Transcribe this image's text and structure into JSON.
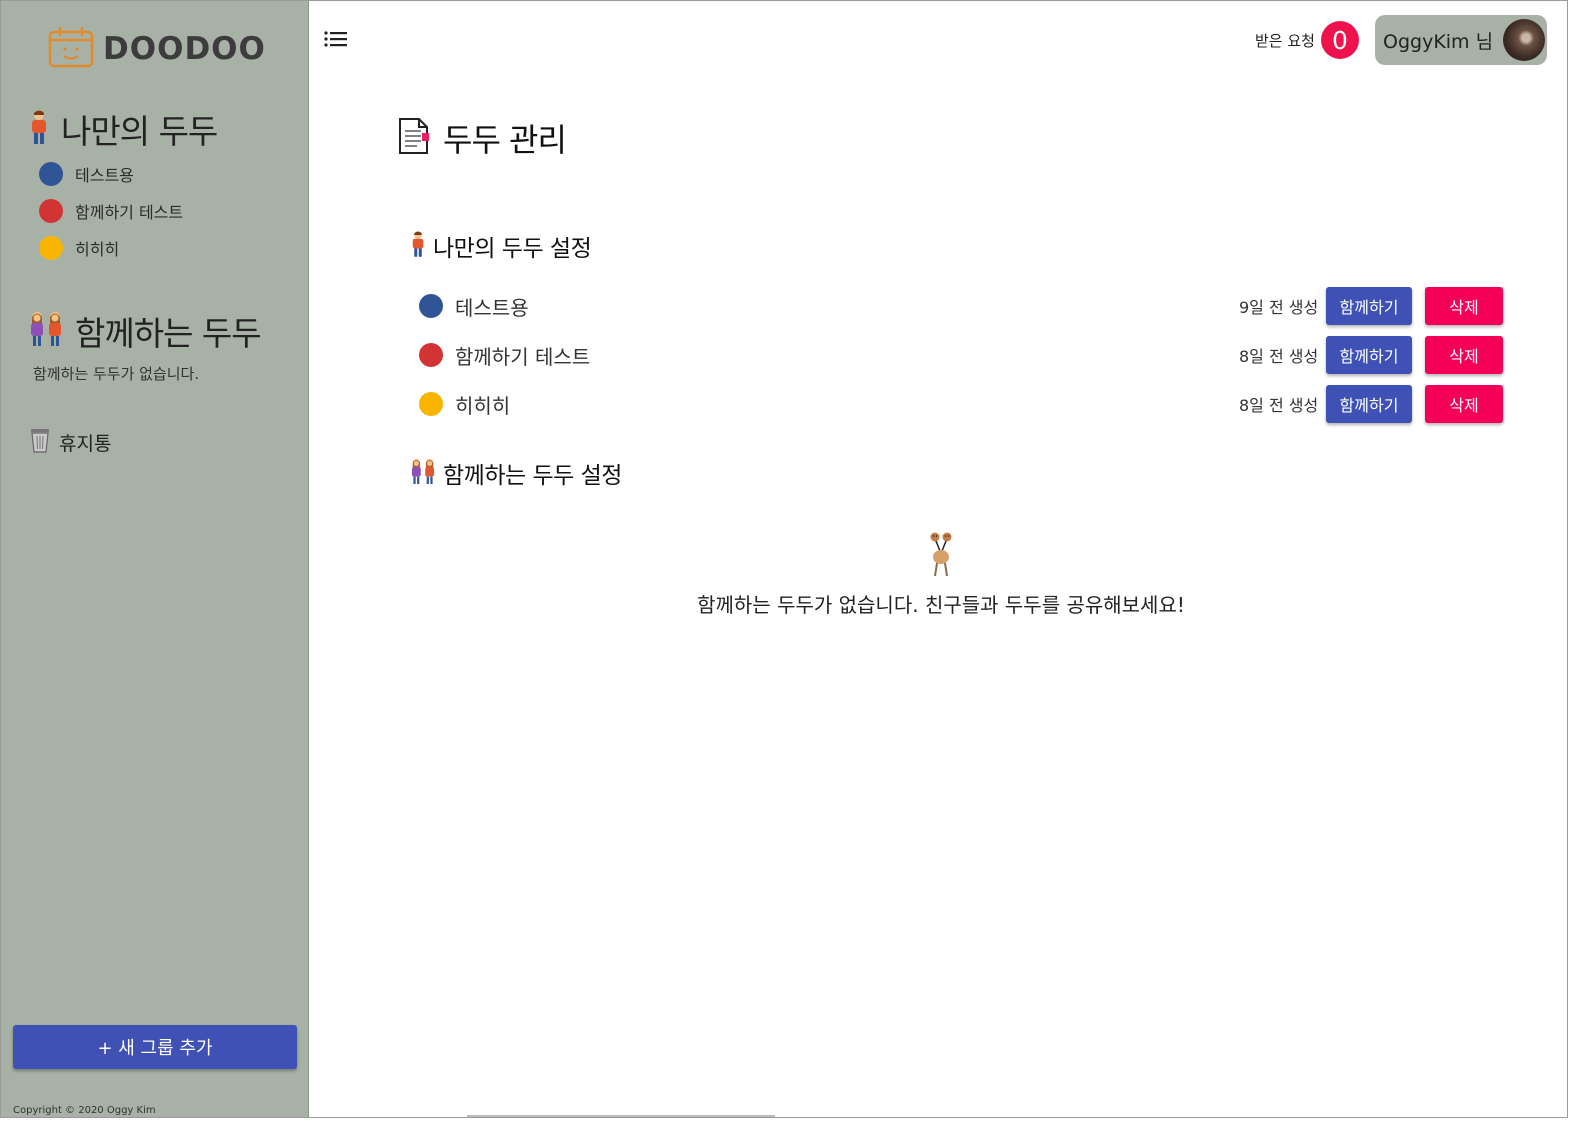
{
  "brand": {
    "name": "DOODOO"
  },
  "sidebar": {
    "my_heading": "나만의 두두",
    "my_items": [
      {
        "label": "테스트용",
        "color": "#2f5597"
      },
      {
        "label": "함께하기 테스트",
        "color": "#d23434"
      },
      {
        "label": "히히히",
        "color": "#f7b500"
      }
    ],
    "shared_heading": "함께하는 두두",
    "shared_empty": "함께하는 두두가 없습니다.",
    "trash_label": "휴지통",
    "new_group_label": "+ 새 그룹 추가",
    "copyright": "Copyright © 2020 Oggy Kim"
  },
  "header": {
    "requests_label": "받은 요청",
    "requests_count": "0",
    "user_label": "OggyKim 님"
  },
  "main": {
    "title": "두두 관리",
    "my_section": {
      "heading": "나만의 두두 설정",
      "rows": [
        {
          "label": "테스트용",
          "color": "#2f5597",
          "created": "9일 전 생성",
          "share": "함께하기",
          "delete": "삭제"
        },
        {
          "label": "함께하기 테스트",
          "color": "#d23434",
          "created": "8일 전 생성",
          "share": "함께하기",
          "delete": "삭제"
        },
        {
          "label": "히히히",
          "color": "#f7b500",
          "created": "8일 전 생성",
          "share": "함께하기",
          "delete": "삭제"
        }
      ]
    },
    "shared_section": {
      "heading": "함께하는 두두 설정",
      "empty_message": "함께하는 두두가 없습니다. 친구들과 두두를 공유해보세요!"
    }
  },
  "colors": {
    "sidebar_bg": "#a8b1a6",
    "primary": "#3f51b5",
    "danger": "#f50057",
    "badge": "#f0124d"
  }
}
